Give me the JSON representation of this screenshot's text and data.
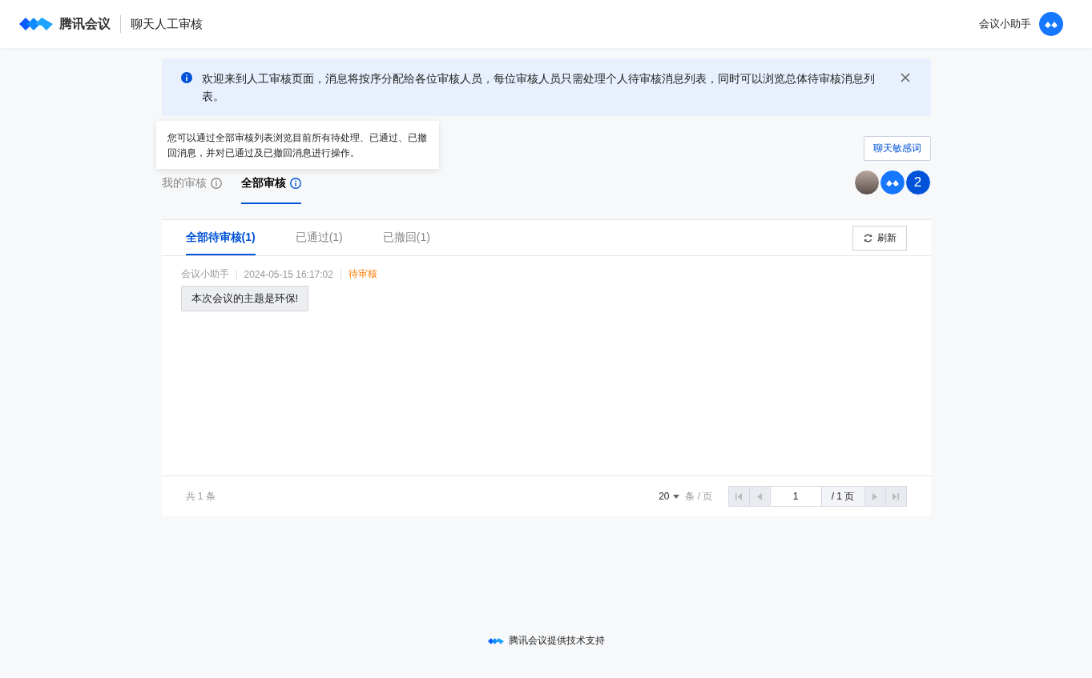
{
  "header": {
    "brand": "腾讯会议",
    "title": "聊天人工审核",
    "user": "会议小助手"
  },
  "banner": {
    "text": "欢迎来到人工审核页面，消息将按序分配给各位审核人员，每位审核人员只需处理个人待审核消息列表，同时可以浏览总体待审核消息列表。"
  },
  "tooltip": {
    "text": "您可以通过全部审核列表浏览目前所有待处理、已通过、已撤回消息，并对已通过及已撤回消息进行操作。"
  },
  "sensitive_button": "聊天敏感词",
  "tabs": [
    {
      "label": "我的审核",
      "selected": false
    },
    {
      "label": "全部审核",
      "selected": true
    }
  ],
  "reviewers": {
    "count": "2"
  },
  "subtabs": [
    {
      "label": "全部待审核(1)",
      "selected": true
    },
    {
      "label": "已通过(1)",
      "selected": false
    },
    {
      "label": "已撤回(1)",
      "selected": false
    }
  ],
  "refresh_button": "刷新",
  "messages": [
    {
      "sender": "会议小助手",
      "time": "2024-05-15 16:17:02",
      "status": "待审核",
      "content": "本次会议的主题是环保!"
    }
  ],
  "pagination": {
    "total": "共 1 条",
    "page_size": "20",
    "page_size_unit": "条 / 页",
    "page": "1",
    "page_total": "/ 1 页"
  },
  "footer": "腾讯会议提供技术支持"
}
